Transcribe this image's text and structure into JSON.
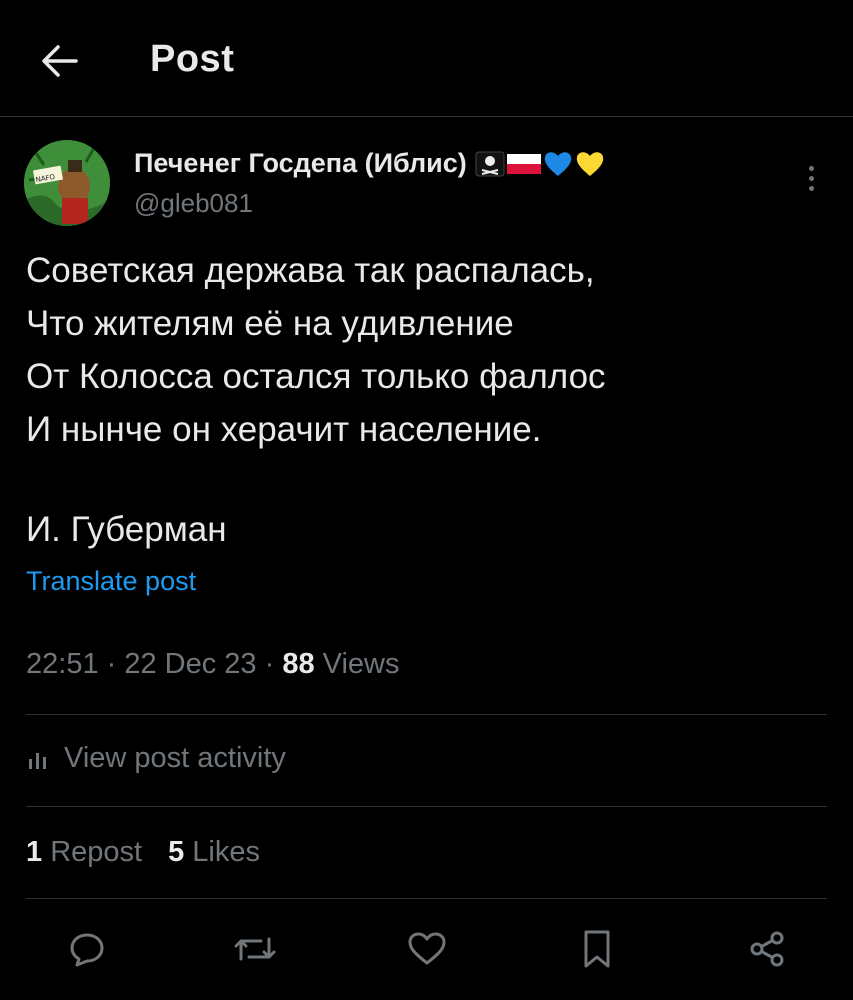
{
  "header": {
    "title": "Post"
  },
  "author": {
    "name": "Печенег Госдепа (Иблис)",
    "handle": "@gleb081",
    "avatar_label": "NAFO",
    "emojis": [
      "skull-crossbones",
      "poland-flag",
      "blue-heart",
      "yellow-heart"
    ]
  },
  "post": {
    "lines": [
      "Советская держава так распалась,",
      "Что жителям её на удивление",
      "От Колосса остался только фаллос",
      "И нынче он херачит население."
    ],
    "signature": "И. Губерман"
  },
  "translate_label": "Translate post",
  "meta": {
    "time": "22:51",
    "sep": " · ",
    "date": "22 Dec 23",
    "views_count": "88",
    "views_label": " Views"
  },
  "activity_label": "View post activity",
  "stats": {
    "reposts_count": "1",
    "reposts_label": "Repost",
    "likes_count": "5",
    "likes_label": "Likes"
  },
  "actions": [
    "reply-icon",
    "repost-icon",
    "like-icon",
    "bookmark-icon",
    "share-icon"
  ],
  "colors": {
    "background": "#000000",
    "text": "#e7e9ea",
    "muted": "#71767b",
    "link": "#1d9bf0",
    "divider": "#2f3336"
  }
}
